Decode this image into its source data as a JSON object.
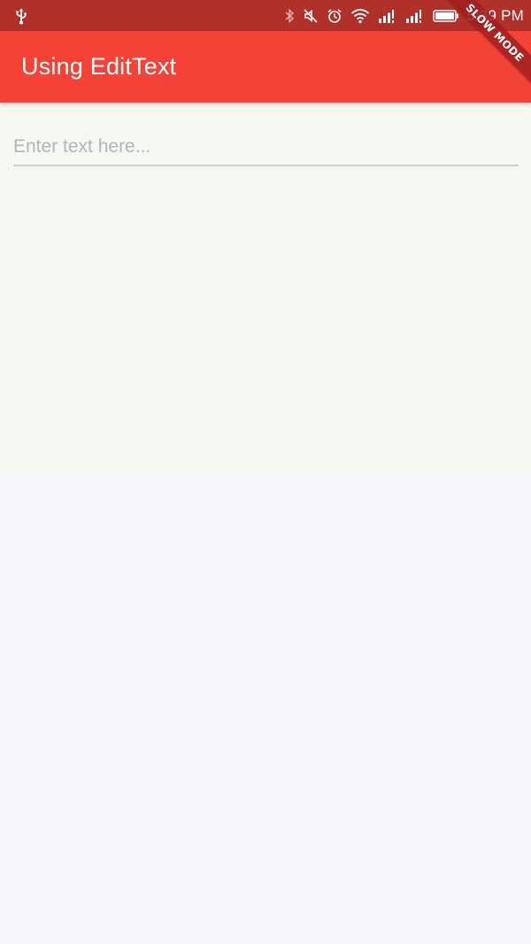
{
  "status_bar": {
    "time": "5:39 PM",
    "icons": [
      "usb-icon",
      "bluetooth-icon",
      "mute-icon",
      "alarm-icon",
      "wifi-icon",
      "signal-icon",
      "signal-r-icon",
      "battery-icon"
    ],
    "background": "#b0302a"
  },
  "app_bar": {
    "title": "Using EditText",
    "background": "#f44336"
  },
  "debug_banner": {
    "label": "SLOW MODE"
  },
  "edit_text": {
    "placeholder": "Enter text here...",
    "value": ""
  },
  "colors": {
    "content_panel": "#f5f9f1",
    "page": "#f6f5f8",
    "underline": "#cfcfcf"
  }
}
